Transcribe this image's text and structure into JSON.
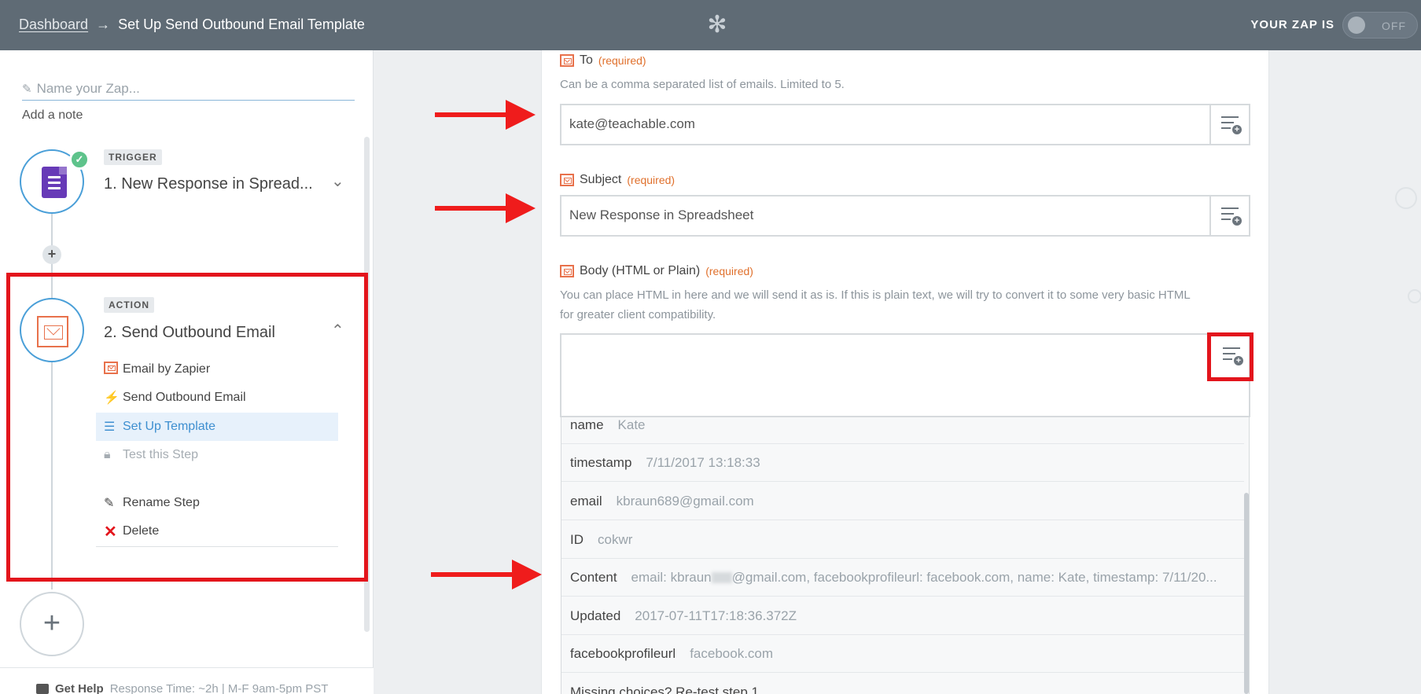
{
  "header": {
    "breadcrumb_link": "Dashboard",
    "breadcrumb_arrow": "→",
    "breadcrumb_current": "Set Up Send Outbound Email Template",
    "zap_status_label": "YOUR ZAP IS",
    "toggle_label": "OFF"
  },
  "sidebar": {
    "zap_name_placeholder": "Name your Zap...",
    "add_note": "Add a note",
    "trigger": {
      "tag": "TRIGGER",
      "title": "1. New Response in Spread..."
    },
    "action": {
      "tag": "ACTION",
      "title": "2. Send Outbound Email",
      "substeps": [
        {
          "label": "Email by Zapier",
          "icon": "email-icon"
        },
        {
          "label": "Send Outbound Email",
          "icon": "lightning-icon"
        },
        {
          "label": "Set Up Template",
          "icon": "list-icon"
        },
        {
          "label": "Test this Step",
          "icon": "lock-icon"
        },
        {
          "label": "Rename Step",
          "icon": "pencil-icon"
        },
        {
          "label": "Delete",
          "icon": "x-icon"
        }
      ]
    },
    "footer": {
      "help": "Get Help",
      "response": "Response Time: ~2h | M-F 9am-5pm PST"
    }
  },
  "form": {
    "to": {
      "label": "To",
      "required": "(required)",
      "hint": "Can be a comma separated list of emails. Limited to 5.",
      "value": "kate@teachable.com"
    },
    "subject": {
      "label": "Subject",
      "required": "(required)",
      "value": "New Response in Spreadsheet"
    },
    "body": {
      "label": "Body (HTML or Plain)",
      "required": "(required)",
      "hint1": "You can place HTML in here and we will send it as is. If this is plain text, we will try to convert it to some very basic HTML",
      "hint2": "for greater client compatibility.",
      "value": ""
    }
  },
  "dropdown": {
    "rows": [
      {
        "key": "name",
        "value": "Kate"
      },
      {
        "key": "timestamp",
        "value": "7/11/2017 13:18:33"
      },
      {
        "key": "email",
        "value": "kbraun689@gmail.com"
      },
      {
        "key": "ID",
        "value": "cokwr"
      },
      {
        "key": "Content",
        "value_pre": "email: kbraun",
        "value_post": "@gmail.com, facebookprofileurl: facebook.com, name: Kate, timestamp: 7/11/20..."
      },
      {
        "key": "Updated",
        "value": "2017-07-11T17:18:36.372Z"
      },
      {
        "key": "facebookprofileurl",
        "value": "facebook.com"
      }
    ],
    "missing": "Missing choices? Re-test step 1."
  },
  "colors": {
    "header_bg": "#5f6b75",
    "accent_blue": "#4a9fd8",
    "required_orange": "#e0702c",
    "annotation_red": "#ef1c1c"
  }
}
